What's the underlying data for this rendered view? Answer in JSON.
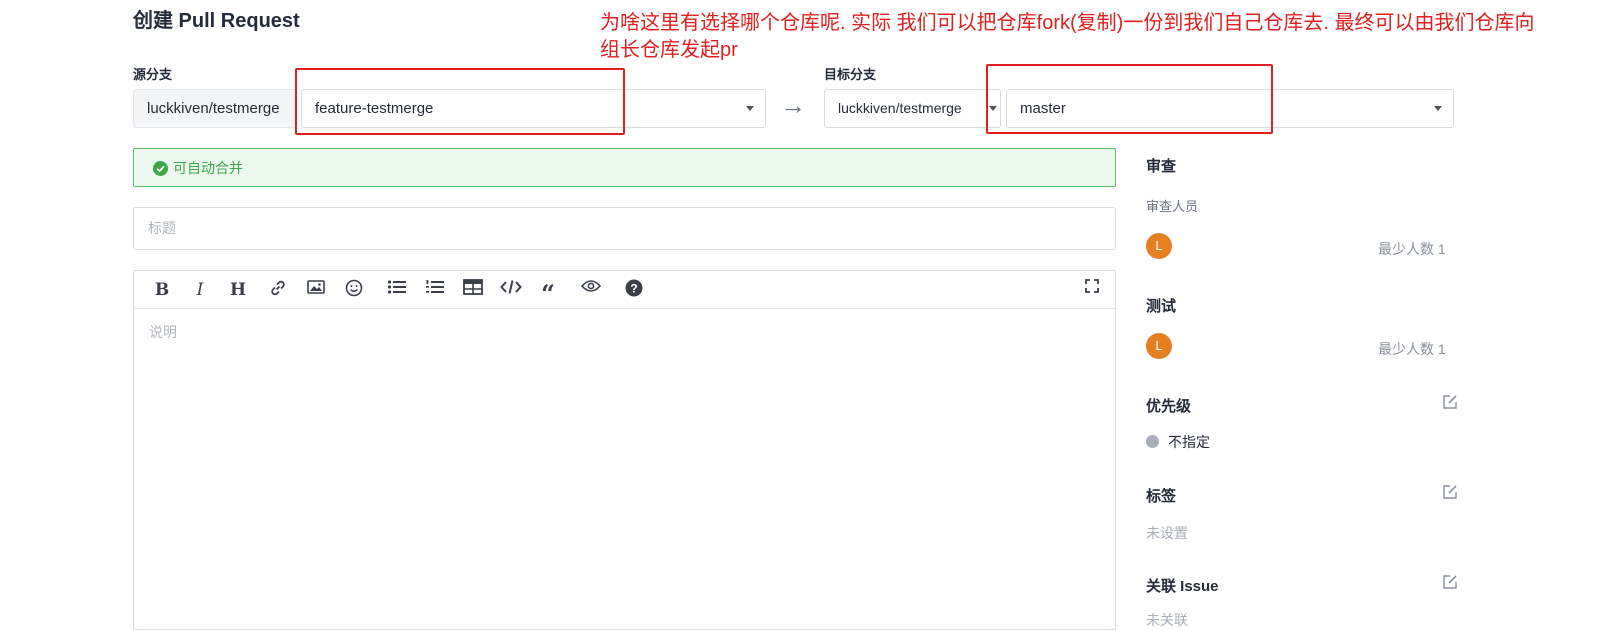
{
  "page": {
    "title": "创建 Pull Request",
    "annotation": "为啥这里有选择哪个仓库呢. 实际 我们可以把仓库fork(复制)一份到我们自己仓库去. 最终可以由我们仓库向组长仓库发起pr"
  },
  "source": {
    "label": "源分支",
    "repo": "luckkiven/testmerge",
    "branch": "feature-testmerge"
  },
  "target": {
    "label": "目标分支",
    "repo": "luckkiven/testmerge",
    "branch": "master"
  },
  "arrow": "→",
  "merge_status": {
    "text": "可自动合并",
    "color": "#3fa74a"
  },
  "title_input": {
    "placeholder": "标题"
  },
  "editor": {
    "placeholder": "说明",
    "toolbar": [
      "bold-icon",
      "italic-icon",
      "heading-icon",
      "link-icon",
      "image-icon",
      "emoji-icon",
      "bullet-list-icon",
      "numbered-list-icon",
      "table-icon",
      "code-icon",
      "quote-icon",
      "preview-icon",
      "help-icon",
      "fullscreen-icon"
    ]
  },
  "sidebar": {
    "review": {
      "title": "审查",
      "reviewers_label": "审查人员",
      "reviewer_avatar": "L",
      "min_label": "最少人数 1"
    },
    "test": {
      "title": "测试",
      "tester_avatar": "L",
      "min_label": "最少人数 1"
    },
    "priority": {
      "title": "优先级",
      "value": "不指定"
    },
    "labels": {
      "title": "标签",
      "value": "未设置"
    },
    "issue": {
      "title": "关联 Issue",
      "value": "未关联"
    }
  },
  "colors": {
    "annotation": "#e02020",
    "avatar": "#e67e22",
    "success": "#3fa74a"
  }
}
